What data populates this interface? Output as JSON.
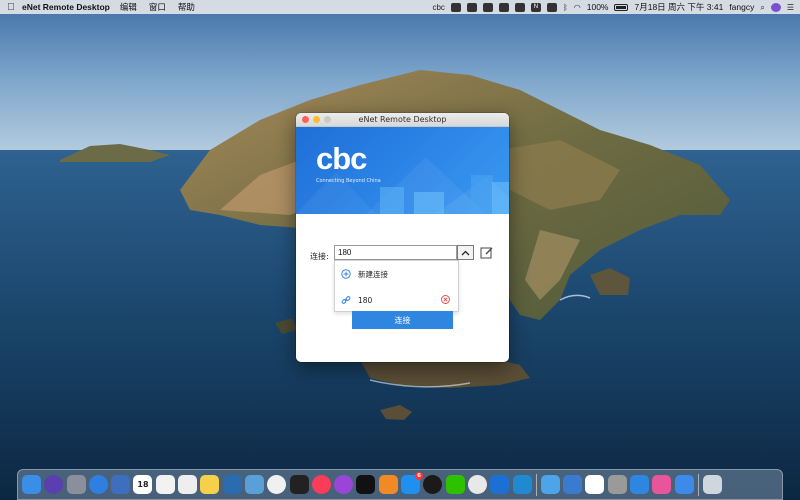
{
  "menubar": {
    "app_name": "eNet Remote Desktop",
    "menus": [
      "编辑",
      "窗口",
      "帮助"
    ],
    "battery_percent": "100%",
    "datetime": "7月18日 周六 下午 3:41",
    "user": "fangcy"
  },
  "window": {
    "title": "eNet Remote Desktop",
    "banner": {
      "logo": "cbc",
      "tagline": "Connecting Beyond China",
      "color": "#2d86e8"
    },
    "form": {
      "label": "连接:",
      "input_value": "180",
      "dropdown_items": [
        {
          "label": "新建连接",
          "icon": "plus-circle-icon"
        },
        {
          "label": "180",
          "icon": "link-icon",
          "deletable": true
        }
      ],
      "connect_button": "连接"
    }
  },
  "dock": {
    "apps": [
      {
        "name": "finder",
        "color": "#3a8ee6"
      },
      {
        "name": "siri",
        "color": "#5a3fb0"
      },
      {
        "name": "launchpad",
        "color": "#8a8f99"
      },
      {
        "name": "safari",
        "color": "#2f7fe0"
      },
      {
        "name": "photo-slideshow",
        "color": "#3e6fbf"
      },
      {
        "name": "calendar",
        "color": "#ffffff",
        "text": "18"
      },
      {
        "name": "notes-list",
        "color": "#f2f2f2"
      },
      {
        "name": "textedit",
        "color": "#eeeeee"
      },
      {
        "name": "notes",
        "color": "#f5d04a"
      },
      {
        "name": "quicktime",
        "color": "#2b6cb0"
      },
      {
        "name": "preview",
        "color": "#5aa0d8"
      },
      {
        "name": "photos",
        "color": "#f0f0f0"
      },
      {
        "name": "terminal",
        "color": "#222222"
      },
      {
        "name": "music",
        "color": "#fa3c59"
      },
      {
        "name": "podcasts",
        "color": "#9b45d8"
      },
      {
        "name": "tv",
        "color": "#111111"
      },
      {
        "name": "books",
        "color": "#f08a24"
      },
      {
        "name": "app-store",
        "color": "#1f8ff0",
        "badge": "6"
      },
      {
        "name": "qq",
        "color": "#1a1a1a"
      },
      {
        "name": "wechat",
        "color": "#2dc100"
      },
      {
        "name": "chrome",
        "color": "#e8e8e8"
      },
      {
        "name": "xcode",
        "color": "#1c6fd3"
      },
      {
        "name": "vscode",
        "color": "#1f8ad2"
      },
      {
        "name": "folder",
        "color": "#4ea4e8"
      },
      {
        "name": "folder-dark",
        "color": "#3a7bd0"
      },
      {
        "name": "baidu-netdisk",
        "color": "#ffffff"
      },
      {
        "name": "automator",
        "color": "#9a9a9a"
      },
      {
        "name": "uploader",
        "color": "#2f86e0"
      },
      {
        "name": "pink-folder",
        "color": "#e9559a"
      },
      {
        "name": "enet-cbc",
        "color": "#3d8be8"
      },
      {
        "name": "trash",
        "color": "#cfd6dd"
      }
    ]
  }
}
